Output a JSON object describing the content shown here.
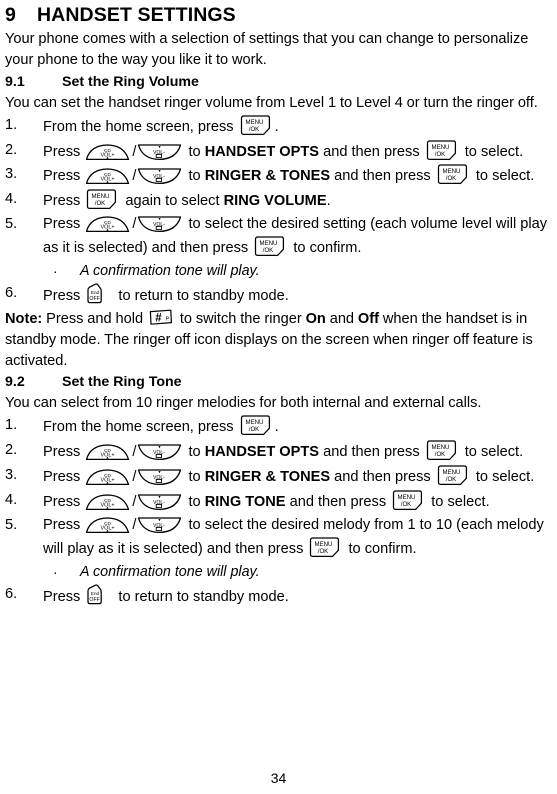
{
  "document": {
    "page_number": "34",
    "chapter": {
      "number": "9",
      "title": "HANDSET SETTINGS"
    },
    "intro": "Your phone comes with a selection of settings that you can change to personalize your phone to the way you like it to work."
  },
  "icons": {
    "menu_ok": {
      "name": "menu-ok-key",
      "line1": "MENU",
      "line2": "/OK"
    },
    "end_off": {
      "name": "end-off-key",
      "line1": "End",
      "line2": "OFF"
    },
    "vol_up": {
      "name": "vol-up-key",
      "line1": "CD",
      "line2": "VOL+"
    },
    "vol_down": {
      "name": "vol-down-key",
      "line1": "VOL",
      "line2": "-"
    },
    "hash": {
      "name": "hash-key",
      "label": "#",
      "sub": "P"
    }
  },
  "sections": [
    {
      "number": "9.1",
      "title": "Set the Ring Volume",
      "intro": "You can set the handset ringer volume from Level 1 to Level 4 or turn the ringer off.",
      "steps": [
        {
          "marker": "1.",
          "parts": [
            {
              "t": "text",
              "v": "From the home screen, press "
            },
            {
              "t": "icon",
              "v": "menu_ok"
            },
            {
              "t": "text",
              "v": "."
            }
          ]
        },
        {
          "marker": "2.",
          "parts": [
            {
              "t": "text",
              "v": "Press "
            },
            {
              "t": "icon",
              "v": "vol_up"
            },
            {
              "t": "text",
              "v": "/"
            },
            {
              "t": "icon",
              "v": "vol_down"
            },
            {
              "t": "text",
              "v": " to "
            },
            {
              "t": "bold",
              "v": "HANDSET OPTS"
            },
            {
              "t": "text",
              "v": " and then press "
            },
            {
              "t": "icon",
              "v": "menu_ok"
            },
            {
              "t": "text",
              "v": " to select."
            }
          ]
        },
        {
          "marker": "3.",
          "parts": [
            {
              "t": "text",
              "v": "Press "
            },
            {
              "t": "icon",
              "v": "vol_up"
            },
            {
              "t": "text",
              "v": "/"
            },
            {
              "t": "icon",
              "v": "vol_down"
            },
            {
              "t": "text",
              "v": " to "
            },
            {
              "t": "bold",
              "v": "RINGER & TONES"
            },
            {
              "t": "text",
              "v": " and then press "
            },
            {
              "t": "icon",
              "v": "menu_ok"
            },
            {
              "t": "text",
              "v": " to select."
            }
          ]
        },
        {
          "marker": "4.",
          "parts": [
            {
              "t": "text",
              "v": "Press "
            },
            {
              "t": "icon",
              "v": "menu_ok"
            },
            {
              "t": "text",
              "v": " again to select "
            },
            {
              "t": "bold",
              "v": "RING VOLUME"
            },
            {
              "t": "text",
              "v": "."
            }
          ]
        },
        {
          "marker": "5.",
          "parts": [
            {
              "t": "text",
              "v": "Press "
            },
            {
              "t": "icon",
              "v": "vol_up"
            },
            {
              "t": "text",
              "v": "/"
            },
            {
              "t": "icon",
              "v": "vol_down"
            },
            {
              "t": "text",
              "v": "  to select the desired setting (each volume level will play as it is selected) and then press "
            },
            {
              "t": "icon",
              "v": "menu_ok"
            },
            {
              "t": "text",
              "v": " to confirm."
            }
          ],
          "bullet": "A confirmation tone will play."
        },
        {
          "marker": "6.",
          "parts": [
            {
              "t": "text",
              "v": "Press "
            },
            {
              "t": "icon",
              "v": "end_off"
            },
            {
              "t": "text",
              "v": " to return to standby mode."
            }
          ]
        }
      ],
      "note": [
        {
          "t": "bold",
          "v": "Note:"
        },
        {
          "t": "text",
          "v": " Press and hold "
        },
        {
          "t": "icon",
          "v": "hash"
        },
        {
          "t": "text",
          "v": " to switch the ringer "
        },
        {
          "t": "bold",
          "v": "On"
        },
        {
          "t": "text",
          "v": " and "
        },
        {
          "t": "bold",
          "v": "Off"
        },
        {
          "t": "text",
          "v": " when the handset is in standby mode. The ringer off icon displays on the screen when ringer off feature is activated."
        }
      ]
    },
    {
      "number": "9.2",
      "title": "Set the Ring Tone",
      "intro": "You can select from 10 ringer melodies for both internal and external calls.",
      "steps": [
        {
          "marker": "1.",
          "parts": [
            {
              "t": "text",
              "v": "From the home screen, press "
            },
            {
              "t": "icon",
              "v": "menu_ok"
            },
            {
              "t": "text",
              "v": "."
            }
          ]
        },
        {
          "marker": "2.",
          "parts": [
            {
              "t": "text",
              "v": "Press "
            },
            {
              "t": "icon",
              "v": "vol_up"
            },
            {
              "t": "text",
              "v": "/"
            },
            {
              "t": "icon",
              "v": "vol_down"
            },
            {
              "t": "text",
              "v": "  to "
            },
            {
              "t": "bold",
              "v": "HANDSET OPTS"
            },
            {
              "t": "text",
              "v": " and then press "
            },
            {
              "t": "icon",
              "v": "menu_ok"
            },
            {
              "t": "text",
              "v": " to select."
            }
          ]
        },
        {
          "marker": "3.",
          "parts": [
            {
              "t": "text",
              "v": "Press "
            },
            {
              "t": "icon",
              "v": "vol_up"
            },
            {
              "t": "text",
              "v": "/"
            },
            {
              "t": "icon",
              "v": "vol_down"
            },
            {
              "t": "text",
              "v": " to "
            },
            {
              "t": "bold",
              "v": "RINGER & TONES"
            },
            {
              "t": "text",
              "v": " and then press "
            },
            {
              "t": "icon",
              "v": "menu_ok"
            },
            {
              "t": "text",
              "v": " to select."
            }
          ]
        },
        {
          "marker": "4.",
          "parts": [
            {
              "t": "text",
              "v": "Press "
            },
            {
              "t": "icon",
              "v": "vol_up"
            },
            {
              "t": "text",
              "v": "/"
            },
            {
              "t": "icon",
              "v": "vol_down"
            },
            {
              "t": "text",
              "v": "  to "
            },
            {
              "t": "bold",
              "v": "RING TONE"
            },
            {
              "t": "text",
              "v": " and then press "
            },
            {
              "t": "icon",
              "v": "menu_ok"
            },
            {
              "t": "text",
              "v": " to select."
            }
          ]
        },
        {
          "marker": "5.",
          "parts": [
            {
              "t": "text",
              "v": "Press "
            },
            {
              "t": "icon",
              "v": "vol_up"
            },
            {
              "t": "text",
              "v": "/"
            },
            {
              "t": "icon",
              "v": "vol_down"
            },
            {
              "t": "text",
              "v": "  to select the desired melody from 1 to 10 (each melody will play as it is selected) and then press "
            },
            {
              "t": "icon",
              "v": "menu_ok"
            },
            {
              "t": "text",
              "v": " to confirm."
            }
          ],
          "bullet": "A confirmation tone will play."
        },
        {
          "marker": "6.",
          "parts": [
            {
              "t": "text",
              "v": "Press "
            },
            {
              "t": "icon",
              "v": "end_off"
            },
            {
              "t": "text",
              "v": " to return to standby mode."
            }
          ]
        }
      ]
    }
  ]
}
